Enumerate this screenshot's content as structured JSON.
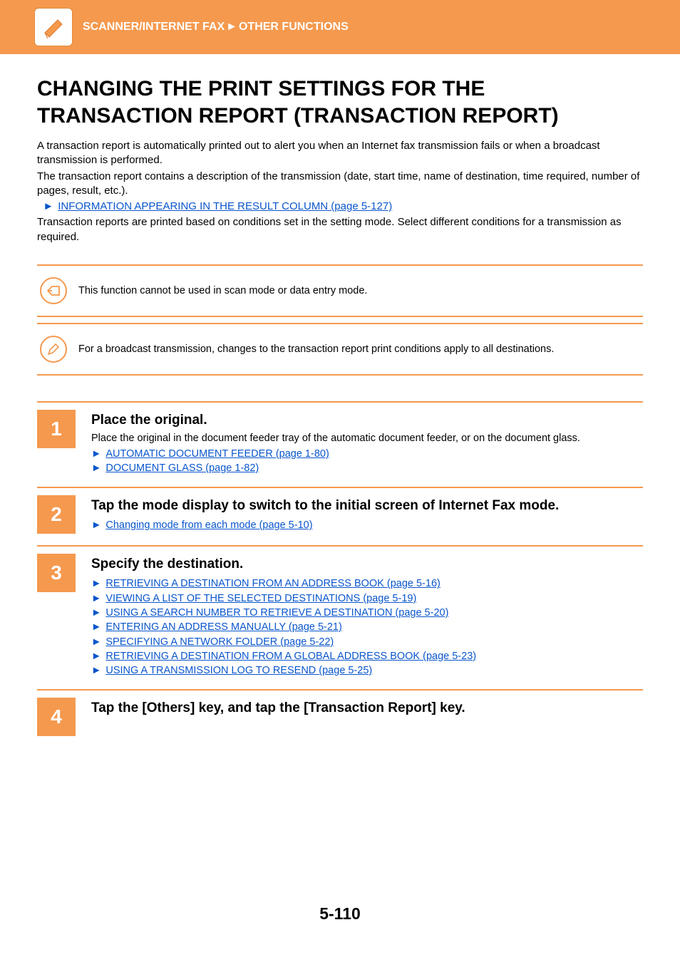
{
  "header": {
    "breadcrumb1": "SCANNER/INTERNET FAX",
    "sep": "►",
    "breadcrumb2": "OTHER FUNCTIONS"
  },
  "title": "CHANGING THE PRINT SETTINGS FOR THE TRANSACTION REPORT (TRANSACTION REPORT)",
  "intro": {
    "p1": "A transaction report is automatically printed out to alert you when an Internet fax transmission fails or when a broadcast transmission is performed.",
    "p2": "The transaction report contains a description of the transmission (date, start time, name of destination, time required, number of pages, result, etc.).",
    "link_arrow": "►",
    "link_text": "INFORMATION APPEARING IN THE RESULT COLUMN (page 5-127)",
    "p3": "Transaction reports are printed based on conditions set in the setting mode. Select different conditions for a transmission as required."
  },
  "notes": {
    "note1": "This function cannot be used in scan mode or data entry mode.",
    "note2": "For a broadcast transmission, changes to the transaction report print conditions apply to all destinations."
  },
  "steps": [
    {
      "num": "1",
      "title": "Place the original.",
      "desc": "Place the original in the document feeder tray of the automatic document feeder, or on the document glass.",
      "links": [
        "AUTOMATIC DOCUMENT FEEDER (page 1-80)",
        "DOCUMENT GLASS (page 1-82)"
      ]
    },
    {
      "num": "2",
      "title": "Tap the mode display to switch to the initial screen of Internet Fax mode.",
      "desc": "",
      "links": [
        "Changing mode from each mode (page 5-10)"
      ]
    },
    {
      "num": "3",
      "title": "Specify the destination.",
      "desc": "",
      "links": [
        "RETRIEVING A DESTINATION FROM AN ADDRESS BOOK (page 5-16)",
        "VIEWING A LIST OF THE SELECTED DESTINATIONS (page 5-19)",
        "USING A SEARCH NUMBER TO RETRIEVE A DESTINATION (page 5-20)",
        "ENTERING AN ADDRESS MANUALLY (page 5-21)",
        "SPECIFYING A NETWORK FOLDER (page 5-22)",
        "RETRIEVING A DESTINATION FROM A GLOBAL ADDRESS BOOK (page 5-23)",
        "USING A TRANSMISSION LOG TO RESEND (page 5-25)"
      ]
    },
    {
      "num": "4",
      "title": "Tap the [Others] key, and tap the [Transaction Report] key.",
      "desc": "",
      "links": []
    }
  ],
  "page_number": "5-110"
}
